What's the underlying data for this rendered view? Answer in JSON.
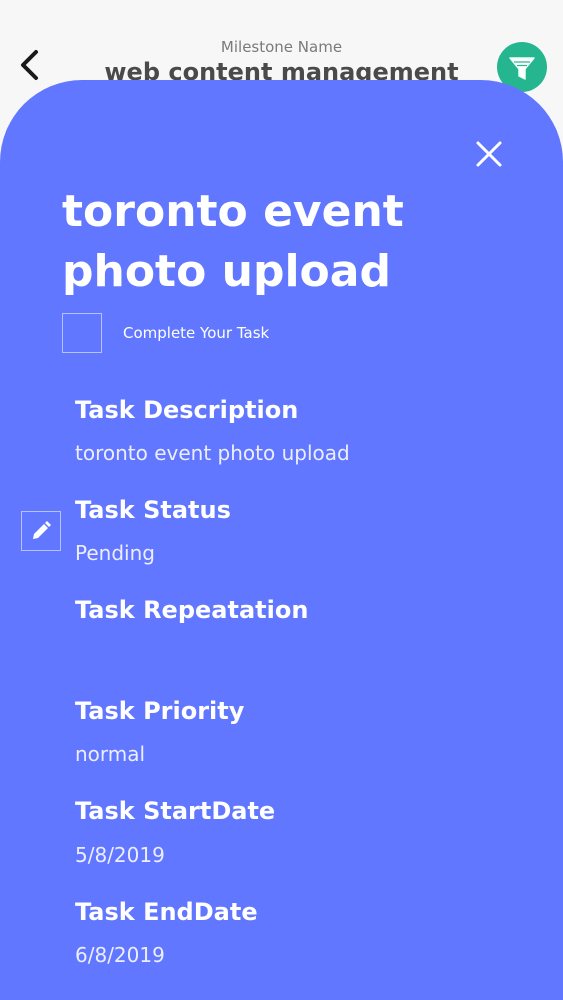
{
  "header": {
    "milestone_label": "Milestone Name",
    "milestone_title": "web content management",
    "back_icon": "chevron-left-icon",
    "filter_icon": "filter-icon"
  },
  "task": {
    "title": "toronto event photo upload",
    "complete_label": "Complete Your Task",
    "completed": false,
    "fields": {
      "description_label": "Task Description",
      "description_value": "toronto event photo upload",
      "status_label": "Task Status",
      "status_value": "Pending",
      "repetition_label": "Task Repeatation",
      "repetition_value": "",
      "priority_label": "Task Priority",
      "priority_value": "normal",
      "startdate_label": "Task StartDate",
      "startdate_value": "5/8/2019",
      "enddate_label": "Task EndDate",
      "enddate_value": "6/8/2019"
    }
  },
  "icons": {
    "close": "close-icon",
    "edit": "pencil-icon"
  },
  "colors": {
    "sheet": "#6177ff",
    "filter_button": "#25b58f",
    "background": "#f7f7f7"
  }
}
